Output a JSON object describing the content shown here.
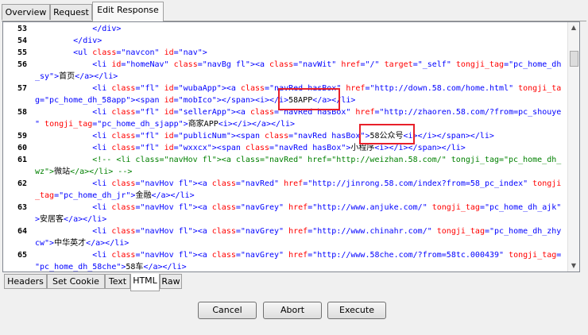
{
  "top_tabs": [
    "Overview",
    "Request",
    "Edit Response"
  ],
  "bottom_tabs": [
    "Headers",
    "Set Cookie",
    "Text",
    "HTML",
    "Raw"
  ],
  "buttons": {
    "cancel": "Cancel",
    "abort": "Abort",
    "execute": "Execute"
  },
  "line_numbers": [
    "53",
    "54",
    "55",
    "56",
    "57",
    "58",
    "59",
    "60",
    "61",
    "62",
    "63",
    "64",
    "65"
  ],
  "code_lines": [
    [
      [
        "t",
        "            </div>"
      ]
    ],
    [
      [
        "t",
        "        </div>"
      ]
    ],
    [
      [
        "t",
        "        <ul "
      ],
      [
        "a",
        "class"
      ],
      [
        "t",
        "=\"navcon\" "
      ],
      [
        "a",
        "id"
      ],
      [
        "t",
        "=\"nav\">"
      ]
    ],
    [
      [
        "t",
        "            <li "
      ],
      [
        "a",
        "id"
      ],
      [
        "t",
        "=\"homeNav\" "
      ],
      [
        "a",
        "class"
      ],
      [
        "t",
        "=\"navBg fl\"><a "
      ],
      [
        "a",
        "class"
      ],
      [
        "t",
        "=\"navWit\" "
      ],
      [
        "a",
        "href"
      ],
      [
        "t",
        "=\"/\" "
      ],
      [
        "a",
        "target"
      ],
      [
        "t",
        "=\"_self\" "
      ],
      [
        "a",
        "tongji_tag"
      ],
      [
        "t",
        "=\"pc_home_dh"
      ]
    ],
    [
      [
        "t",
        "_sy\">"
      ],
      [
        "txt",
        "首页"
      ],
      [
        "t",
        "</a></li>"
      ]
    ],
    [
      [
        "t",
        "            <li "
      ],
      [
        "a",
        "class"
      ],
      [
        "t",
        "=\"fl\" "
      ],
      [
        "a",
        "id"
      ],
      [
        "t",
        "=\"wubaApp\"><a "
      ],
      [
        "a",
        "class"
      ],
      [
        "t",
        "=\"navRed hasBox\" "
      ],
      [
        "a",
        "href"
      ],
      [
        "t",
        "=\"http://down.58.com/home.html\" "
      ],
      [
        "a",
        "tongji_ta"
      ]
    ],
    [
      [
        "t",
        "g=\"pc_home_dh_58app\"><span "
      ],
      [
        "a",
        "id"
      ],
      [
        "t",
        "=\"mobIco\"></span><i></i>"
      ],
      [
        "txt",
        "58APP"
      ],
      [
        "t",
        "</a></li>"
      ]
    ],
    [
      [
        "t",
        "            <li "
      ],
      [
        "a",
        "class"
      ],
      [
        "t",
        "=\"fl\" "
      ],
      [
        "a",
        "id"
      ],
      [
        "t",
        "=\"sellerApp\"><a "
      ],
      [
        "a",
        "class"
      ],
      [
        "t",
        "=\"navRed hasBox\" "
      ],
      [
        "a",
        "href"
      ],
      [
        "t",
        "=\"http://zhaoren.58.com/?from=pc_shouye"
      ]
    ],
    [
      [
        "t",
        "\" "
      ],
      [
        "a",
        "tongji_tag"
      ],
      [
        "t",
        "=\"pc_home_dh_sjapp\">"
      ],
      [
        "txt",
        "商家APP"
      ],
      [
        "t",
        "<i></i></a></li>"
      ]
    ],
    [
      [
        "t",
        "            <li "
      ],
      [
        "a",
        "class"
      ],
      [
        "t",
        "=\"fl\" "
      ],
      [
        "a",
        "id"
      ],
      [
        "t",
        "=\"publicNum\"><span "
      ],
      [
        "a",
        "class"
      ],
      [
        "t",
        "=\"navRed hasBox\">"
      ],
      [
        "txt",
        "58公众号"
      ],
      [
        "t",
        "<i></i></span></li>"
      ]
    ],
    [
      [
        "t",
        "            <li "
      ],
      [
        "a",
        "class"
      ],
      [
        "t",
        "=\"fl\" "
      ],
      [
        "a",
        "id"
      ],
      [
        "t",
        "=\"wxxcx\"><span "
      ],
      [
        "a",
        "class"
      ],
      [
        "t",
        "=\"navRed hasBox\">"
      ],
      [
        "txt",
        "小程序"
      ],
      [
        "t",
        "<i></i></span></li>"
      ]
    ],
    [
      [
        "c",
        "            <!-- <li class=\"navHov fl\"><a class=\"navRed\" href=\"http://weizhan.58.com/\" tongji_tag=\"pc_home_dh_"
      ]
    ],
    [
      [
        "c",
        "wz\">"
      ],
      [
        "txt",
        "微站"
      ],
      [
        "c",
        "</a></li> -->"
      ]
    ],
    [
      [
        "t",
        "            <li "
      ],
      [
        "a",
        "class"
      ],
      [
        "t",
        "=\"navHov fl\"><a "
      ],
      [
        "a",
        "class"
      ],
      [
        "t",
        "=\"navRed\" "
      ],
      [
        "a",
        "href"
      ],
      [
        "t",
        "=\"http://jinrong.58.com/index?from=58_pc_index\" "
      ],
      [
        "a",
        "tongji"
      ]
    ],
    [
      [
        "a",
        "_tag"
      ],
      [
        "t",
        "=\"pc_home_dh_jr\">"
      ],
      [
        "txt",
        "金融"
      ],
      [
        "t",
        "</a></li>"
      ]
    ],
    [
      [
        "t",
        "            <li "
      ],
      [
        "a",
        "class"
      ],
      [
        "t",
        "=\"navHov fl\"><a "
      ],
      [
        "a",
        "class"
      ],
      [
        "t",
        "=\"navGrey\" "
      ],
      [
        "a",
        "href"
      ],
      [
        "t",
        "=\"http://www.anjuke.com/\" "
      ],
      [
        "a",
        "tongji_tag"
      ],
      [
        "t",
        "=\"pc_home_dh_ajk\""
      ]
    ],
    [
      [
        "t",
        ">"
      ],
      [
        "txt",
        "安居客"
      ],
      [
        "t",
        "</a></li>"
      ]
    ],
    [
      [
        "t",
        "            <li "
      ],
      [
        "a",
        "class"
      ],
      [
        "t",
        "=\"navHov fl\"><a "
      ],
      [
        "a",
        "class"
      ],
      [
        "t",
        "=\"navGrey\" "
      ],
      [
        "a",
        "href"
      ],
      [
        "t",
        "=\"http://www.chinahr.com/\" "
      ],
      [
        "a",
        "tongji_tag"
      ],
      [
        "t",
        "=\"pc_home_dh_zhy"
      ]
    ],
    [
      [
        "t",
        "cw\">"
      ],
      [
        "txt",
        "中华英才"
      ],
      [
        "t",
        "</a></li>"
      ]
    ],
    [
      [
        "t",
        "            <li "
      ],
      [
        "a",
        "class"
      ],
      [
        "t",
        "=\"navHov fl\"><a "
      ],
      [
        "a",
        "class"
      ],
      [
        "t",
        "=\"navGrey\" "
      ],
      [
        "a",
        "href"
      ],
      [
        "t",
        "=\"http://www.58che.com/?from=58tc.000439\" "
      ],
      [
        "a",
        "tongji_tag"
      ],
      [
        "t",
        "="
      ]
    ],
    [
      [
        "t",
        "\"pc_home_dh_58che\">"
      ],
      [
        "txt",
        "58车"
      ],
      [
        "t",
        "</a></li>"
      ]
    ]
  ]
}
